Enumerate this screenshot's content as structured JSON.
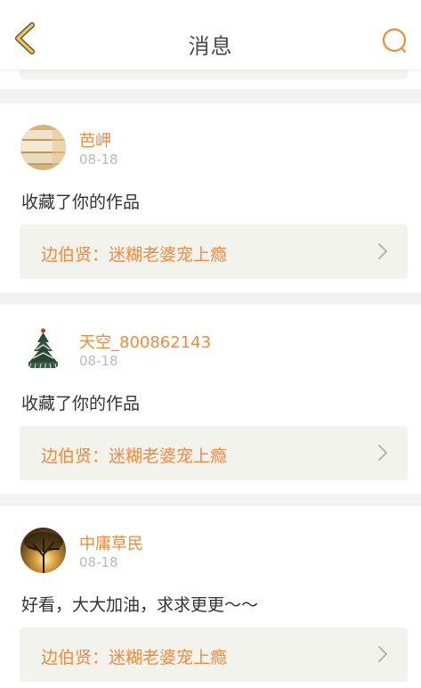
{
  "header": {
    "title": "消息"
  },
  "colors": {
    "accent": "#f08a3e",
    "back_icon": "#f0c64a",
    "date": "#b9b9b9",
    "card_bg": "#f3f3ee",
    "divider": "#f2f2f2"
  },
  "messages": [
    {
      "user": "芭岬",
      "date": "08-18",
      "text": "收藏了你的作品",
      "work": "边伯贤：迷糊老婆宠上瘾",
      "avatar_icon": "folded-fabric-avatar"
    },
    {
      "user": "天空_800862143",
      "date": "08-18",
      "text": "收藏了你的作品",
      "work": "边伯贤：迷糊老婆宠上瘾",
      "avatar_icon": "christmas-tree-avatar"
    },
    {
      "user": "中庸草民",
      "date": "08-18",
      "text": "好看，大大加油，求求更更～～",
      "work": "边伯贤：迷糊老婆宠上瘾",
      "avatar_icon": "sunset-tree-avatar"
    }
  ]
}
